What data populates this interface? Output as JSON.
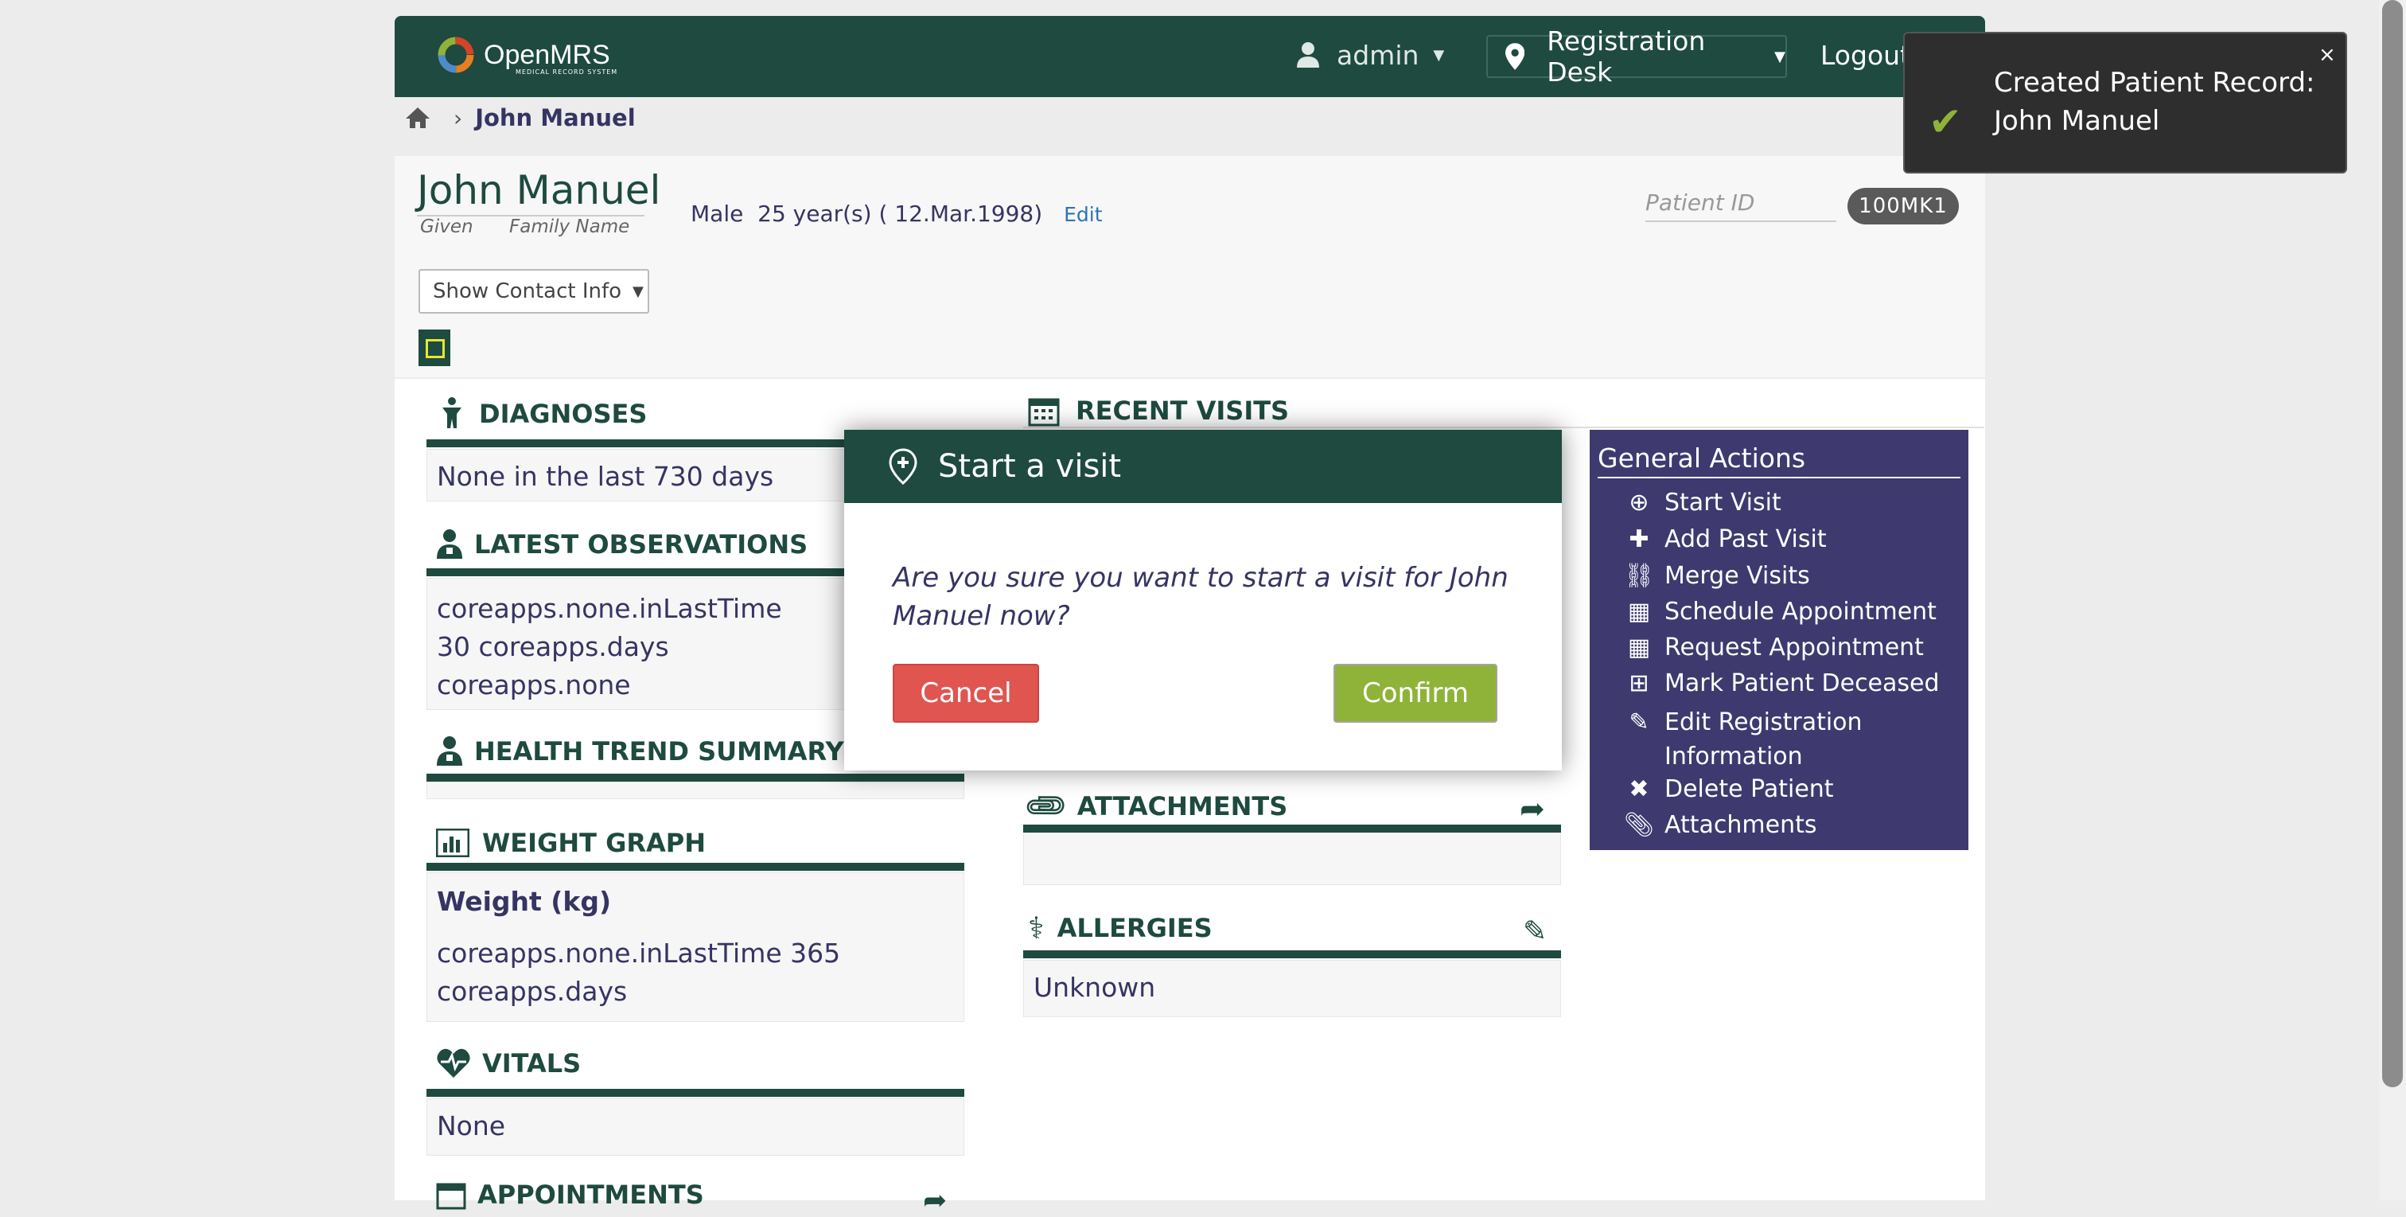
{
  "app": {
    "logo_text": "OpenMRS",
    "logo_sub": "MEDICAL RECORD SYSTEM",
    "user": "admin",
    "location": "Registration Desk",
    "logout": "Logout"
  },
  "breadcrumb": {
    "current": "John Manuel"
  },
  "patient": {
    "name": "John Manuel",
    "given_label": "Given",
    "family_label": "Family Name",
    "gender": "Male",
    "age": "25 year(s) ( 12.Mar.1998)",
    "edit": "Edit",
    "id_label": "Patient ID",
    "id_value": "100MK1",
    "contact_btn": "Show Contact Info"
  },
  "sections": {
    "diagnoses": {
      "title": "DIAGNOSES",
      "body": "None in the last 730 days"
    },
    "observations": {
      "title": "LATEST OBSERVATIONS",
      "line1": "coreapps.none.inLastTime",
      "line2": "30 coreapps.days",
      "line3": "coreapps.none"
    },
    "health_trend": {
      "title": "HEALTH TREND SUMMARY"
    },
    "weight": {
      "title": "WEIGHT GRAPH",
      "subtitle": "Weight (kg)",
      "line1": "coreapps.none.inLastTime 365",
      "line2": "coreapps.days"
    },
    "vitals": {
      "title": "VITALS",
      "body": "None"
    },
    "appointments": {
      "title": "APPOINTMENTS"
    },
    "recent_visits": {
      "title": "RECENT VISITS"
    },
    "attachments": {
      "title": "ATTACHMENTS"
    },
    "allergies": {
      "title": "ALLERGIES",
      "body": "Unknown"
    }
  },
  "dialog": {
    "title": "Start a visit",
    "message": "Are you sure you want to start a visit for John Manuel now?",
    "cancel": "Cancel",
    "confirm": "Confirm"
  },
  "general_actions": {
    "title": "General Actions",
    "items": [
      {
        "label": "Start Visit",
        "icon": "location-plus-icon"
      },
      {
        "label": "Add Past Visit",
        "icon": "plus-icon"
      },
      {
        "label": "Merge Visits",
        "icon": "link-icon"
      },
      {
        "label": "Schedule Appointment",
        "icon": "calendar-icon"
      },
      {
        "label": "Request Appointment",
        "icon": "calendar-icon"
      },
      {
        "label": "Mark Patient Deceased",
        "icon": "plus-square-icon"
      },
      {
        "label": "Edit Registration Information",
        "icon": "pencil-icon"
      },
      {
        "label": "Delete Patient",
        "icon": "x-icon"
      },
      {
        "label": "Attachments",
        "icon": "paperclip-icon"
      }
    ]
  },
  "toast": {
    "message": "Created Patient Record: John Manuel",
    "close": "×"
  },
  "colors": {
    "primary": "#1e4a3f",
    "accent_purple": "#3e3a6f",
    "cancel": "#e05550",
    "confirm": "#8fb339"
  }
}
